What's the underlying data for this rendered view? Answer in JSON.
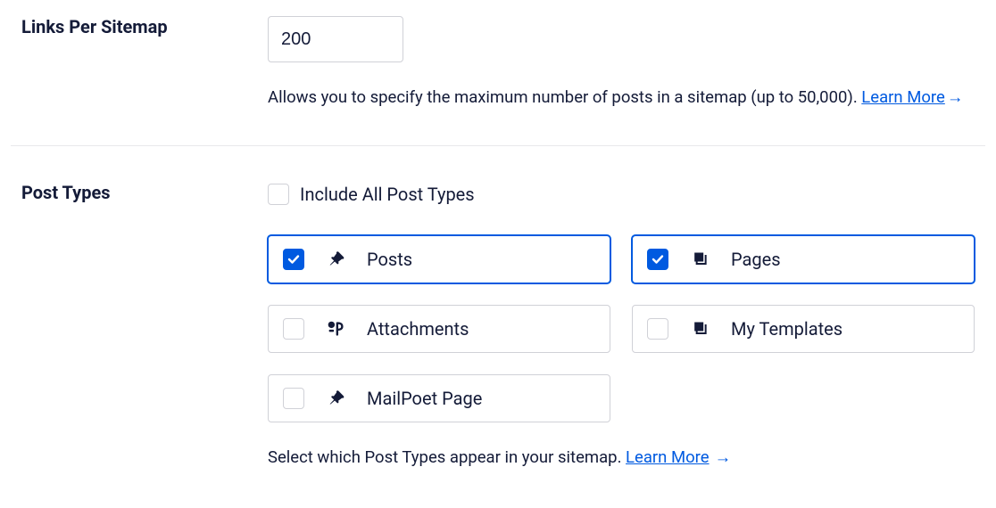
{
  "links_row": {
    "label": "Links Per Sitemap",
    "value": "200",
    "desc": "Allows you to specify the maximum number of posts in a sitemap (up to 50,000). ",
    "learn_more": "Learn More",
    "arrow": "→"
  },
  "post_types_row": {
    "label": "Post Types",
    "include_all_label": "Include All Post Types",
    "include_all_checked": false,
    "types": [
      {
        "id": "posts",
        "label": "Posts",
        "icon": "pin",
        "checked": true
      },
      {
        "id": "pages",
        "label": "Pages",
        "icon": "stack",
        "checked": true
      },
      {
        "id": "attachments",
        "label": "Attachments",
        "icon": "media",
        "checked": false
      },
      {
        "id": "my-templates",
        "label": "My Templates",
        "icon": "stack",
        "checked": false
      },
      {
        "id": "mailpoet-page",
        "label": "MailPoet Page",
        "icon": "pin",
        "checked": false
      }
    ],
    "desc": "Select which Post Types appear in your sitemap. ",
    "learn_more": "Learn More",
    "arrow": "→"
  }
}
